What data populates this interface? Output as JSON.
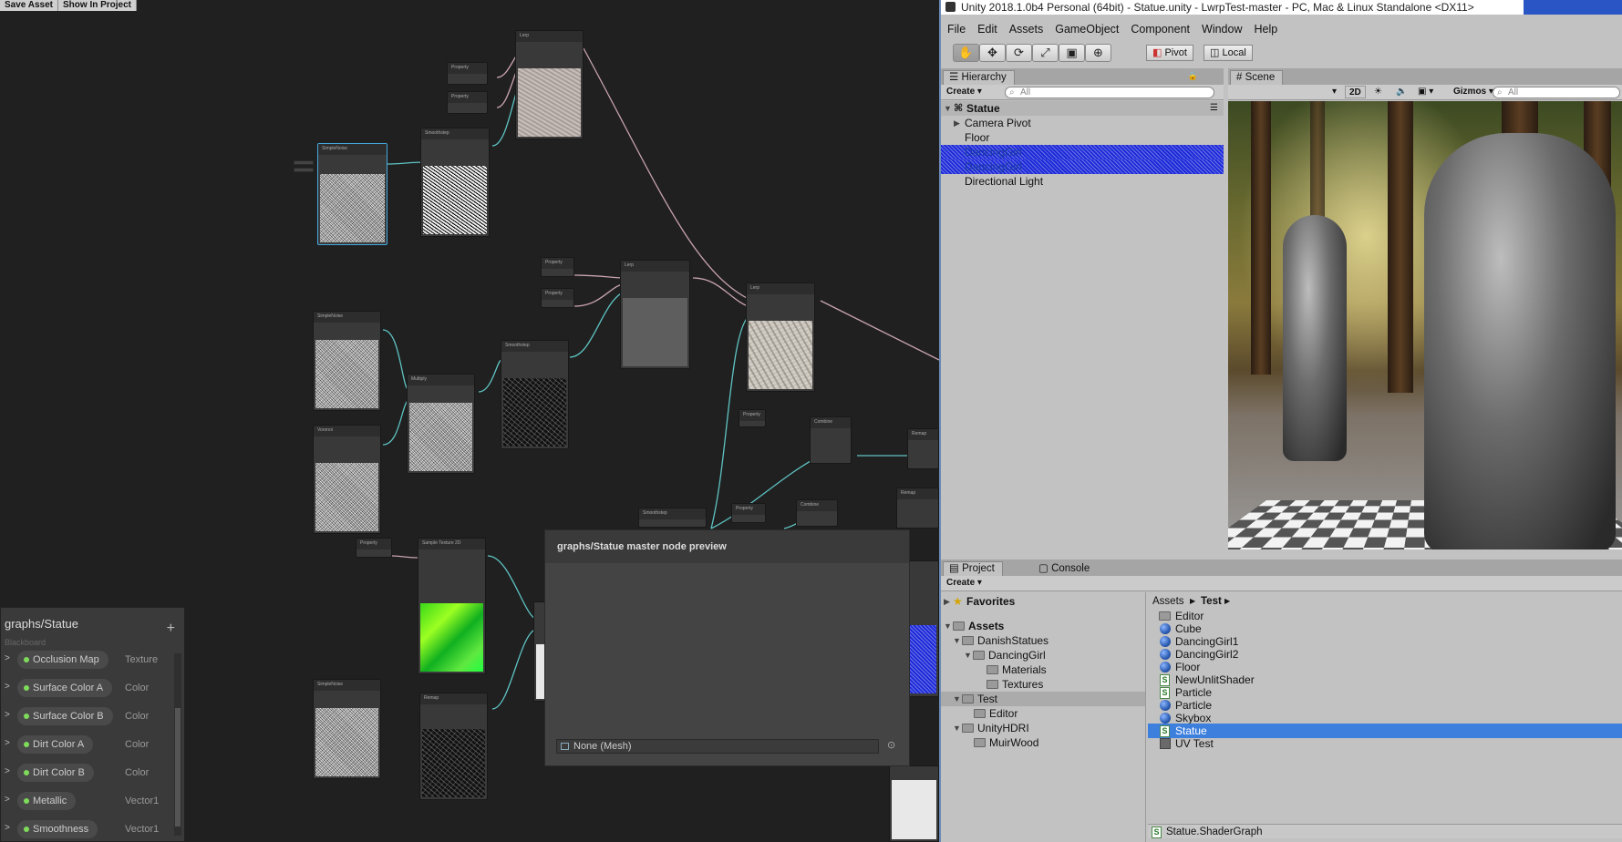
{
  "shader_graph": {
    "toolbar": {
      "save_asset": "Save Asset",
      "show_in_project": "Show In Project"
    },
    "blackboard": {
      "title": "graphs/Statue",
      "subtitle": "Blackboard",
      "add_icon": "+",
      "properties": [
        {
          "name": "Occlusion Map",
          "type": "Texture"
        },
        {
          "name": "Surface Color A",
          "type": "Color"
        },
        {
          "name": "Surface Color B",
          "type": "Color"
        },
        {
          "name": "Dirt Color A",
          "type": "Color"
        },
        {
          "name": "Dirt Color B",
          "type": "Color"
        },
        {
          "name": "Metallic",
          "type": "Vector1"
        },
        {
          "name": "Smoothness",
          "type": "Vector1"
        }
      ]
    },
    "master_preview": {
      "title": "graphs/Statue master node preview",
      "mesh_field": "None (Mesh)"
    }
  },
  "unity": {
    "title": "Unity 2018.1.0b4 Personal (64bit) - Statue.unity - LwrpTest-master - PC, Mac & Linux Standalone <DX11>",
    "menu": [
      "File",
      "Edit",
      "Assets",
      "GameObject",
      "Component",
      "Window",
      "Help"
    ],
    "toolbar": {
      "pivot": "Pivot",
      "local": "Local"
    },
    "hierarchy": {
      "tab": "Hierarchy",
      "create": "Create",
      "search_placeholder": "All",
      "scene_name": "Statue",
      "items": [
        {
          "label": "Camera Pivot",
          "style": "normal",
          "has_children": true
        },
        {
          "label": "Floor",
          "style": "normal",
          "has_children": false
        },
        {
          "label": "DancingGirl",
          "style": "prefab",
          "has_children": false
        },
        {
          "label": "DancingGirl",
          "style": "prefab",
          "has_children": false
        },
        {
          "label": "Directional Light",
          "style": "normal",
          "has_children": false
        }
      ]
    },
    "scene": {
      "tab": "Scene",
      "mode_2d": "2D",
      "gizmos": "Gizmos",
      "search_placeholder": "All"
    },
    "project": {
      "tab_project": "Project",
      "tab_console": "Console",
      "create": "Create",
      "favorites": "Favorites",
      "tree": [
        {
          "label": "Assets",
          "depth": 0,
          "bold": true
        },
        {
          "label": "DanishStatues",
          "depth": 1
        },
        {
          "label": "DancingGirl",
          "depth": 2
        },
        {
          "label": "Materials",
          "depth": 3
        },
        {
          "label": "Textures",
          "depth": 3
        },
        {
          "label": "Test",
          "depth": 1,
          "selected": true
        },
        {
          "label": "Editor",
          "depth": 2
        },
        {
          "label": "UnityHDRI",
          "depth": 1
        },
        {
          "label": "MuirWood",
          "depth": 2
        }
      ],
      "breadcrumb": {
        "root": "Assets",
        "current": "Test"
      },
      "files": [
        {
          "label": "Editor",
          "icon": "folder-icon"
        },
        {
          "label": "Cube",
          "icon": "prefab-icon"
        },
        {
          "label": "DancingGirl1",
          "icon": "prefab-icon"
        },
        {
          "label": "DancingGirl2",
          "icon": "prefab-icon"
        },
        {
          "label": "Floor",
          "icon": "prefab-icon"
        },
        {
          "label": "NewUnlitShader",
          "icon": "shader-icon"
        },
        {
          "label": "Particle",
          "icon": "shader-icon"
        },
        {
          "label": "Particle",
          "icon": "prefab-icon"
        },
        {
          "label": "Skybox",
          "icon": "prefab-icon"
        },
        {
          "label": "Statue",
          "icon": "shader-icon",
          "selected": true
        },
        {
          "label": "UV Test",
          "icon": "texture-icon"
        }
      ],
      "status_file": "Statue.ShaderGraph"
    }
  }
}
